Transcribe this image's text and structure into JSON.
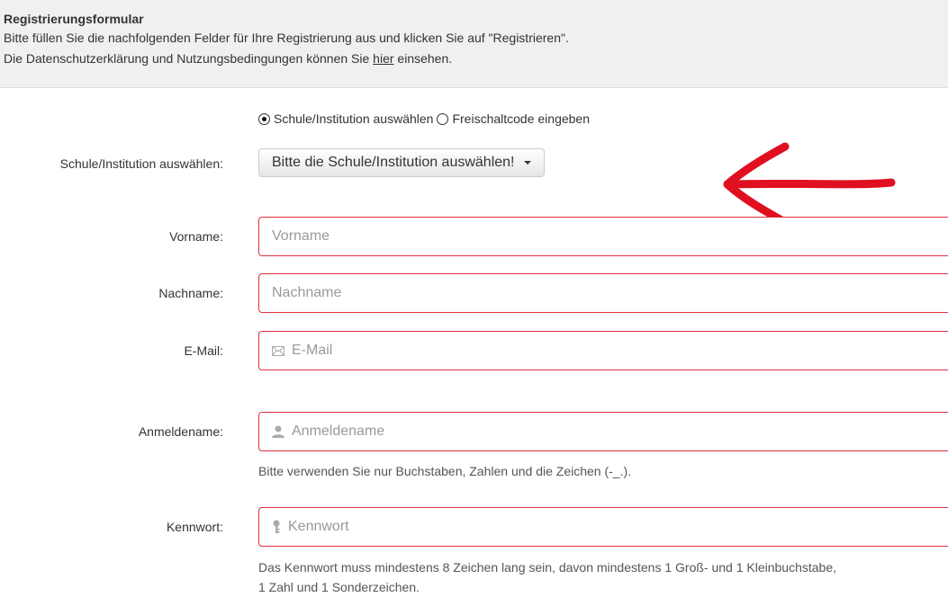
{
  "header": {
    "title": "Registrierungsformular",
    "line1": "Bitte füllen Sie die nachfolgenden Felder für Ihre Registrierung aus und klicken Sie auf \"Registrieren\".",
    "line2_before": "Die Datenschutzerklärung und Nutzungsbedingungen können Sie ",
    "line2_link": "hier",
    "line2_after": " einsehen."
  },
  "mode": {
    "option1": "Schule/Institution auswählen",
    "option2": "Freischaltcode eingeben",
    "selected": "option1"
  },
  "school": {
    "label": "Schule/Institution auswählen:",
    "dropdown_value": "Bitte die Schule/Institution auswählen!"
  },
  "firstname": {
    "label": "Vorname:",
    "placeholder": "Vorname",
    "value": ""
  },
  "lastname": {
    "label": "Nachname:",
    "placeholder": "Nachname",
    "value": ""
  },
  "email": {
    "label": "E-Mail:",
    "placeholder": "E-Mail",
    "value": "",
    "icon": "envelope-icon"
  },
  "username": {
    "label": "Anmeldename:",
    "placeholder": "Anmeldename",
    "value": "",
    "icon": "user-icon",
    "help": "Bitte verwenden Sie nur Buchstaben, Zahlen und die Zeichen (-_.)."
  },
  "password": {
    "label": "Kennwort:",
    "placeholder": "Kennwort",
    "value": "",
    "icon": "key-icon",
    "help_line1": "Das Kennwort muss mindestens 8 Zeichen lang sein, davon mindestens 1 Groß- und 1 Kleinbuchstabe,",
    "help_line2": "1 Zahl und 1 Sonderzeichen."
  },
  "colors": {
    "error_border": "#e0303a",
    "annotation_arrow": "#e01020",
    "header_bg": "#f0f0f0"
  }
}
